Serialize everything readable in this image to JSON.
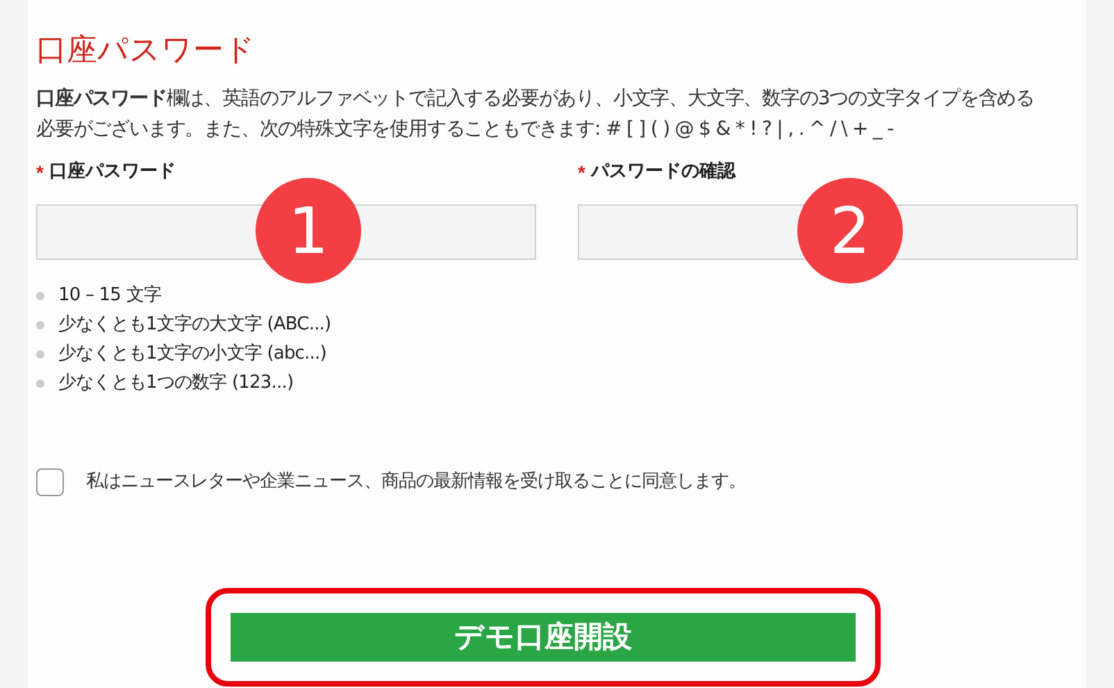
{
  "heading": "口座パスワード",
  "description": "**口座パスワード**欄は、英語のアルファベットで記入する必要があり、小文字、大文字、数字の3つの文字タイプを含める必要がございます。また、次の特殊文字を使用することもできます: # [ ] ( ) @ $ & * ! ? | , . ^ / \\ + _ -",
  "fields": [
    {
      "required_mark": "*",
      "label": "口座パスワード",
      "marker": "1"
    },
    {
      "required_mark": "*",
      "label": "パスワードの確認",
      "marker": "2"
    }
  ],
  "requirements": [
    "10 – 15 文字",
    "少なくとも1文字の大文字 (ABC...)",
    "少なくとも1文字の小文字 (abc...)",
    "少なくとも1つの数字 (123...)"
  ],
  "newsletter": {
    "label": "私はニュースレターや企業ニュース、商品の最新情報を受け取ることに同意します。",
    "checked": false
  },
  "submit": {
    "label": "デモ口座開設",
    "highlighted": true
  }
}
